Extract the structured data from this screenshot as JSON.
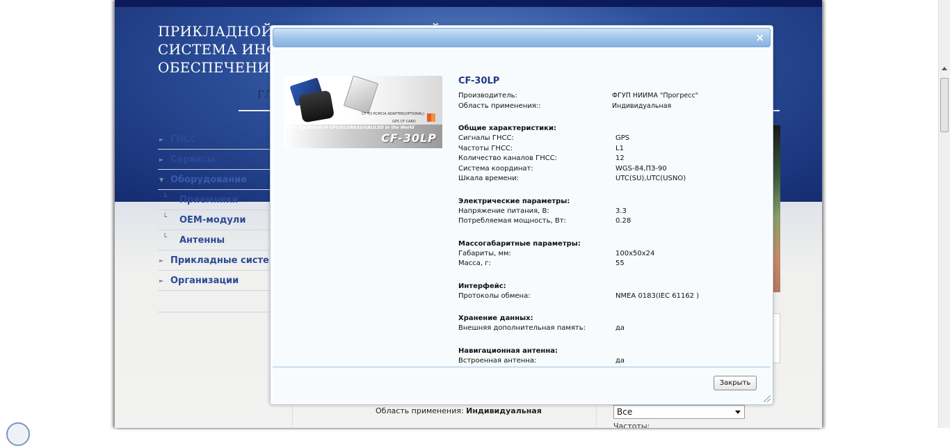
{
  "site": {
    "title_lines": [
      "ПРИКЛАДНОЙ ПОТРЕБИТЕЛЬСКИЙ ЦЕНТР И",
      "СИСТЕМА ИНФО",
      "ОБЕСПЕЧЕНИЯ"
    ],
    "nav_home": "ГЛ"
  },
  "sidebar": {
    "items": [
      {
        "label": "ГНСС"
      },
      {
        "label": "Сервисы"
      },
      {
        "label": "Оборудование"
      },
      {
        "label": "Приемники"
      },
      {
        "label": "OEM-модули"
      },
      {
        "label": "Антенны"
      },
      {
        "label": "Прикладные системы"
      },
      {
        "label": "Организации"
      }
    ]
  },
  "background": {
    "field_label": "Область применения:",
    "field_value": "Индивидуальная",
    "select_value": "Все",
    "label_freq": "Частоты:"
  },
  "modal": {
    "close_glyph": "×",
    "product": {
      "title": "CF-30LP",
      "image_brand": "CF-30LP",
      "image_tagline": "The Top Brand of GPS/GLONASS/GALILEO in the World",
      "image_small1": "CF TO PCMCIA ADAPTER(OPTIONAL)",
      "image_small2": "GPS CF CARD"
    },
    "head_rows": [
      {
        "key": "Производитель:",
        "value": "ФГУП НИИМА \"Прогресс\""
      },
      {
        "key": "Область применения::",
        "value": "Индивидуальная"
      }
    ],
    "sections": [
      {
        "title": "Общие характеристики:",
        "rows": [
          {
            "key": "Сигналы ГНСС:",
            "value": "GPS"
          },
          {
            "key": "Частоты ГНСС:",
            "value": "L1"
          },
          {
            "key": "Количество каналов ГНСС:",
            "value": "12"
          },
          {
            "key": "Система координат:",
            "value": "WGS-84,ПЗ-90"
          },
          {
            "key": "Шкала времени:",
            "value": "UTC(SU),UTC(USNO)"
          }
        ]
      },
      {
        "title": "Электрические параметры:",
        "rows": [
          {
            "key": "Напряжение питания, В:",
            "value": "3.3"
          },
          {
            "key": "Потребляемая мощность, Вт:",
            "value": "0.28"
          }
        ]
      },
      {
        "title": "Массогабаритные параметры:",
        "rows": [
          {
            "key": "Габариты, мм:",
            "value": "100x50x24"
          },
          {
            "key": "Масса, г:",
            "value": "55"
          }
        ]
      },
      {
        "title": "Интерфейс:",
        "rows": [
          {
            "key": "Протоколы обмена:",
            "value": "NMEA 0183(IEC 61162 )"
          }
        ]
      },
      {
        "title": "Хранение данных:",
        "rows": [
          {
            "key": "Внешняя дополнительная память:",
            "value": "да"
          }
        ]
      },
      {
        "title": "Навигационная антенна:",
        "rows": [
          {
            "key": "Встроенная антенна:",
            "value": "да"
          }
        ]
      }
    ],
    "close_button": "Закрыть"
  }
}
